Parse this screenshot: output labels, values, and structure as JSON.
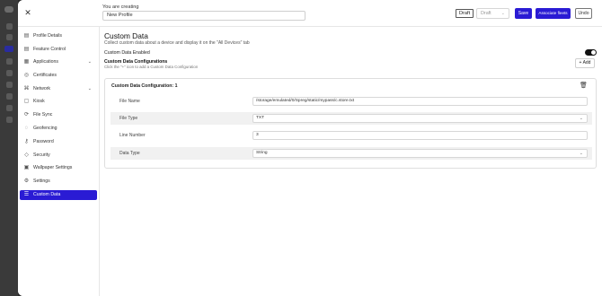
{
  "topbar": {
    "creating_label": "You are creating",
    "profile_name": "New Profile",
    "draft_tag": "Draft",
    "status_value": "Draft",
    "save_label": "Save",
    "associate_label": "Associate fleets",
    "undo_label": "Undo"
  },
  "sidebar": {
    "items": [
      {
        "label": "Profile Details",
        "icon": "document-icon"
      },
      {
        "label": "Feature Control",
        "icon": "document-icon"
      },
      {
        "label": "Applications",
        "icon": "grid-icon",
        "expandable": true
      },
      {
        "label": "Certificates",
        "icon": "certificate-icon"
      },
      {
        "label": "Network",
        "icon": "network-icon",
        "expandable": true
      },
      {
        "label": "Kiosk",
        "icon": "kiosk-icon"
      },
      {
        "label": "File Sync",
        "icon": "sync-icon"
      },
      {
        "label": "Geofencing",
        "icon": "geofence-icon"
      },
      {
        "label": "Password",
        "icon": "key-icon"
      },
      {
        "label": "Security",
        "icon": "shield-icon"
      },
      {
        "label": "Wallpaper Settings",
        "icon": "image-icon"
      },
      {
        "label": "Settings",
        "icon": "gear-icon"
      },
      {
        "label": "Custom Data",
        "icon": "database-icon",
        "active": true
      }
    ]
  },
  "main": {
    "title": "Custom Data",
    "description": "Collect custom data about a device and display it on the \"All Devices\" tab",
    "custom_data_enabled_label": "Custom Data Enabled",
    "custom_data_enabled": true,
    "configs_title": "Custom Data Configurations",
    "configs_hint": "Click the \"+\" icon to add a Custom Data Configuration",
    "add_label": "Add",
    "card": {
      "title": "Custom Data Configuration: 1",
      "fields": [
        {
          "label": "File Name",
          "value": "/storage/emulated/0/Spreg/static/mypass/c.store.txt",
          "type": "text"
        },
        {
          "label": "File Type",
          "value": "TXT",
          "type": "select"
        },
        {
          "label": "Line Number",
          "value": "3",
          "type": "text"
        },
        {
          "label": "Data Type",
          "value": "String",
          "type": "select"
        }
      ]
    }
  },
  "colors": {
    "accent": "#2a1bd4",
    "backdrop": "#2b2b2b"
  }
}
